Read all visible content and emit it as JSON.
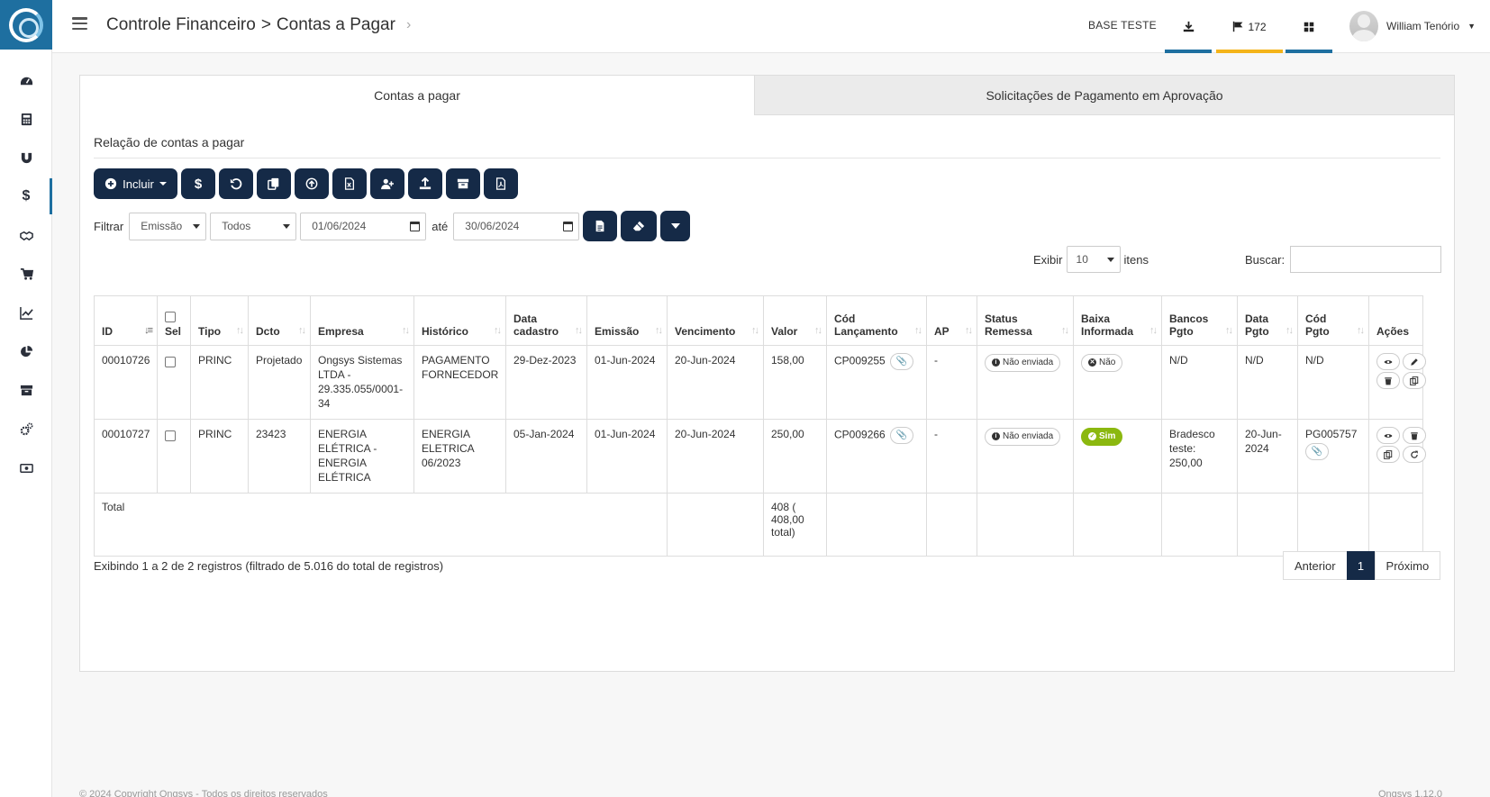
{
  "header": {
    "breadcrumb_part1": "Controle Financeiro",
    "breadcrumb_sep": ">",
    "breadcrumb_part2": "Contas a Pagar",
    "base": "BASE TESTE",
    "flag_count": "172",
    "user_name": "William Tenório",
    "bar_colors": [
      "#1e6fa0",
      "#f4b41a",
      "#1e6fa0"
    ]
  },
  "sidebar": {
    "items": [
      "dashboard-icon",
      "calculator-icon",
      "magnet-icon",
      "dollar-icon",
      "handshake-icon",
      "cart-icon",
      "chart-line-icon",
      "pie-chart-icon",
      "archive-icon",
      "cogs-icon",
      "money-icon"
    ],
    "active_index": 3
  },
  "tabs": [
    "Contas a pagar",
    "Solicitações de Pagamento em Aprovação"
  ],
  "section_title": "Relação de contas a pagar",
  "toolbar": {
    "include_label": "Incluir"
  },
  "filter": {
    "label": "Filtrar",
    "field": "Emissão",
    "status": "Todos",
    "date_from": "01/06/2024",
    "until_label": "até",
    "date_to": "30/06/2024"
  },
  "length": {
    "show_label": "Exibir",
    "value": "10",
    "items_label": "itens"
  },
  "search": {
    "label": "Buscar:"
  },
  "table": {
    "headers": [
      "ID",
      "Sel",
      "Tipo",
      "Dcto",
      "Empresa",
      "Histórico",
      "Data cadastro",
      "Emissão",
      "Vencimento",
      "Valor",
      "Cód Lançamento",
      "AP",
      "Status Remessa",
      "Baixa Informada",
      "Bancos Pgto",
      "Data Pgto",
      "Cód Pgto",
      "Ações"
    ],
    "rows": [
      {
        "id": "00010726",
        "tipo": "PRINC",
        "dcto": "Projetado",
        "empresa": "Ongsys Sistemas LTDA - 29.335.055/0001-34",
        "historico": "PAGAMENTO FORNECEDOR",
        "data_cadastro": "29-Dez-2023",
        "emissao": "01-Jun-2024",
        "vencimento": "20-Jun-2024",
        "valor": "158,00",
        "cod_lancamento": "CP009255",
        "ap": "-",
        "status_remessa": "Não enviada",
        "baixa": "Não",
        "bancos": "N/D",
        "data_pgto": "N/D",
        "cod_pgto": "N/D"
      },
      {
        "id": "00010727",
        "tipo": "PRINC",
        "dcto": "23423",
        "empresa": "ENERGIA ELÉTRICA - ENERGIA ELÉTRICA",
        "historico": "ENERGIA ELETRICA 06/2023",
        "data_cadastro": "05-Jan-2024",
        "emissao": "01-Jun-2024",
        "vencimento": "20-Jun-2024",
        "valor": "250,00",
        "cod_lancamento": "CP009266",
        "ap": "-",
        "status_remessa": "Não enviada",
        "baixa": "Sim",
        "bancos": "Bradesco teste: 250,00",
        "data_pgto": "20-Jun-2024",
        "cod_pgto": "PG005757"
      }
    ],
    "total_label": "Total",
    "total_value": "408 ( 408,00 total)"
  },
  "info": "Exibindo 1 a 2 de 2 registros (filtrado de 5.016 do total de registros)",
  "pager": {
    "prev": "Anterior",
    "current": "1",
    "next": "Próximo"
  },
  "footer": {
    "left": "© 2024 Copyright Ongsys - Todos os direitos reservados",
    "right": "Ongsys 1.12.0"
  }
}
